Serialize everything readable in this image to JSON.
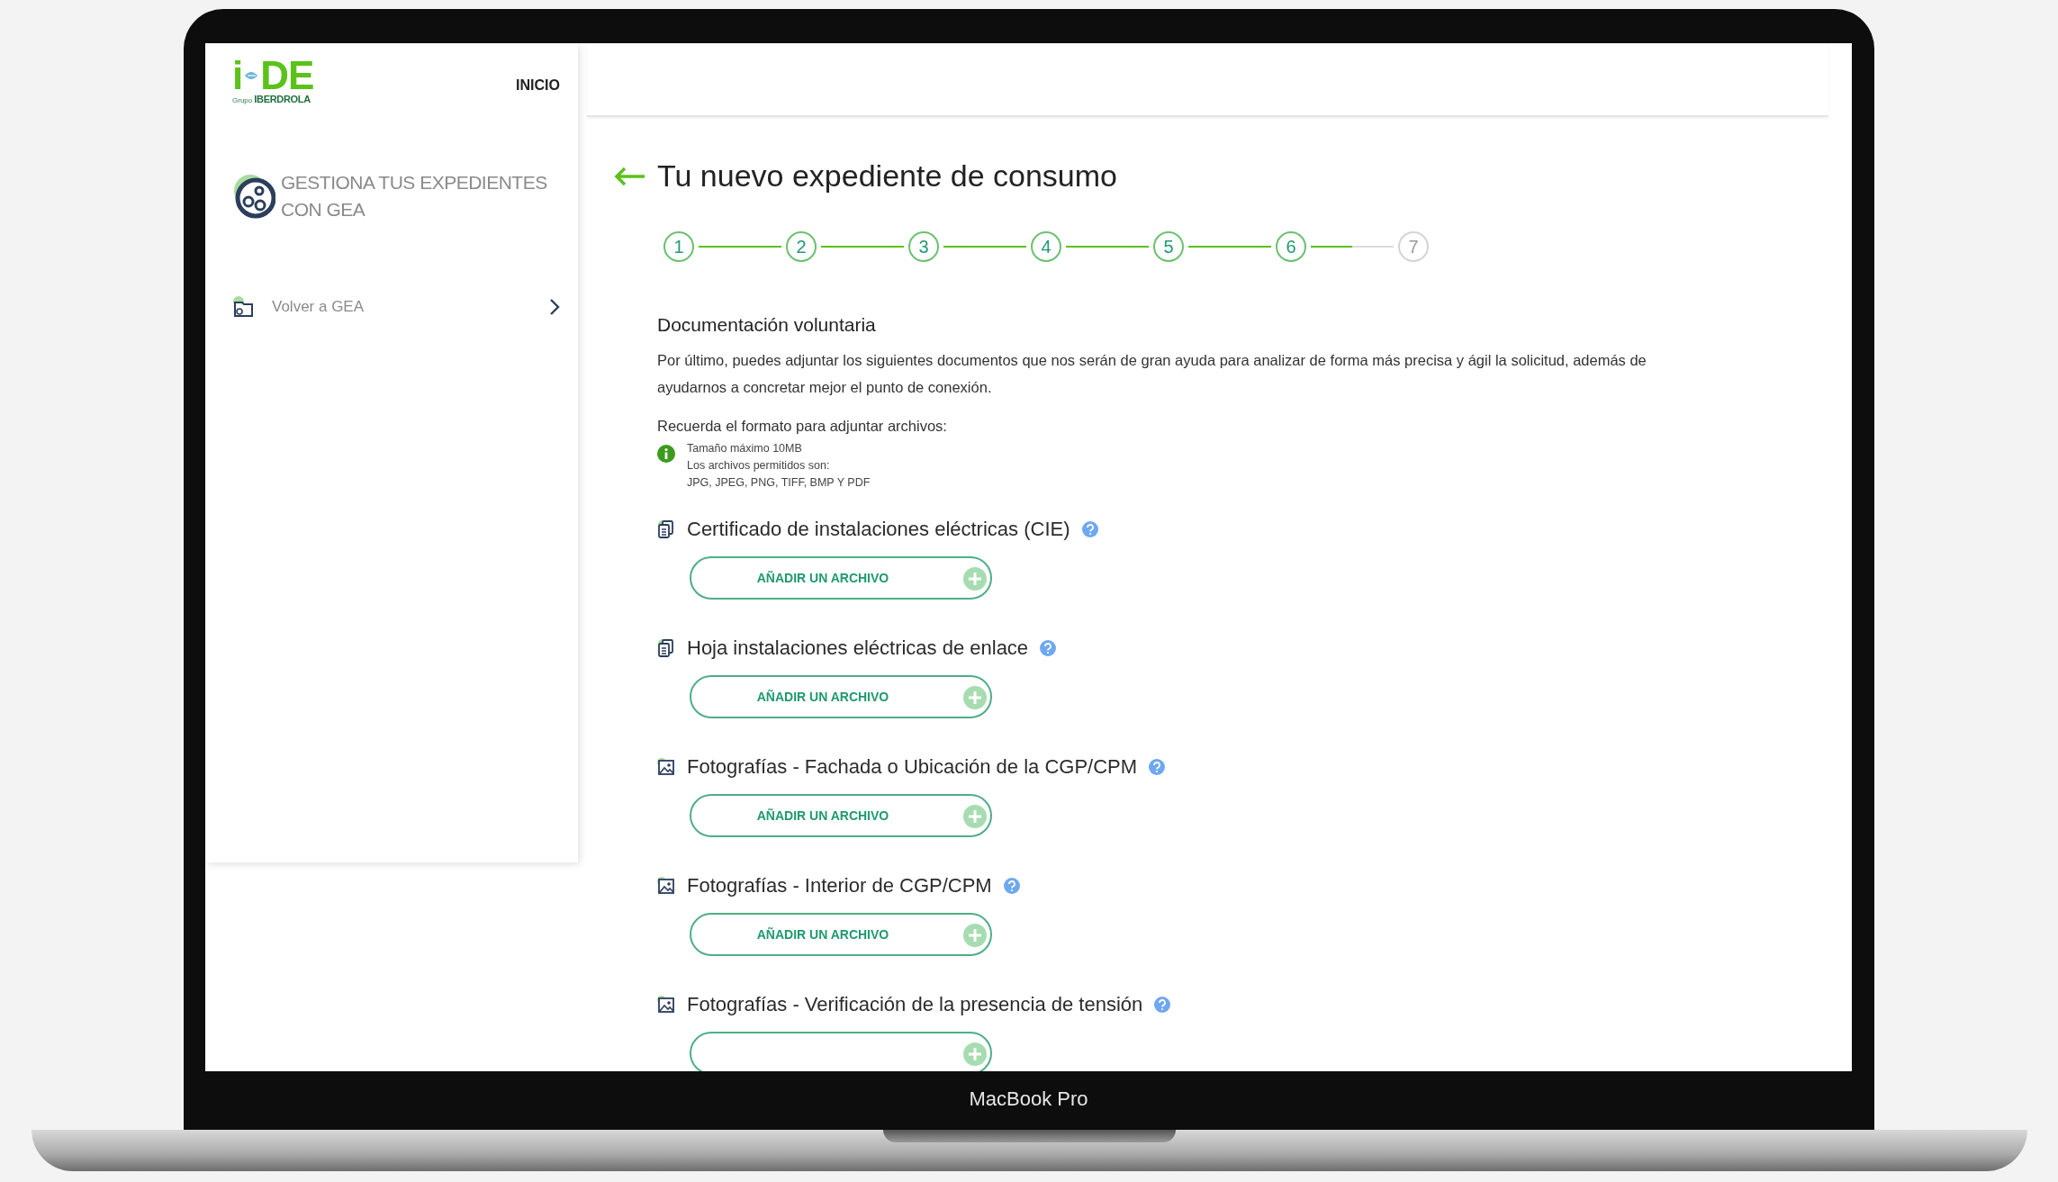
{
  "device": {
    "label": "MacBook Pro"
  },
  "sidebar": {
    "logo": {
      "letter": "i",
      "letters": "DE",
      "group": "Grupo",
      "brand": "IBERDROLA"
    },
    "nav_link": "INICIO",
    "title": "GESTIONA TUS EXPEDIENTES CON GEA",
    "items": [
      {
        "label": "Volver a GEA"
      }
    ]
  },
  "main": {
    "title": "Tu nuevo expediente de consumo",
    "steps": [
      {
        "label": "1",
        "done": true,
        "level": 1
      },
      {
        "label": "2",
        "done": true,
        "level": 1
      },
      {
        "label": "3",
        "done": true,
        "level": 1
      },
      {
        "label": "4",
        "done": true,
        "level": 1
      },
      {
        "label": "5",
        "done": true,
        "level": 1
      },
      {
        "label": "6",
        "done": true,
        "level": 0.5
      },
      {
        "label": "7",
        "done": false
      }
    ],
    "section": {
      "heading": "Documentación voluntaria",
      "intro": "Por último, puedes adjuntar los siguientes documentos que nos serán de gran ayuda para analizar de forma más precisa y ágil la solicitud, además de ayudarnos a concretar mejor el punto de conexión.",
      "format_label": "Recuerda el formato para adjuntar archivos:",
      "format_notes": [
        "Tamaño máximo 10MB",
        "Los archivos permitidos son:",
        "JPG, JPEG, PNG, TIFF, BMP Y PDF"
      ]
    },
    "documents": [
      {
        "kind": "document",
        "title": "Certificado de instalaciones eléctricas (CIE)",
        "button": "AÑADIR UN ARCHIVO"
      },
      {
        "kind": "document",
        "title": "Hoja instalaciones eléctricas de enlace",
        "button": "AÑADIR UN ARCHIVO"
      },
      {
        "kind": "photo",
        "title": "Fotografías - Fachada o Ubicación de la CGP/CPM",
        "button": "AÑADIR UN ARCHIVO"
      },
      {
        "kind": "photo",
        "title": "Fotografías - Interior de CGP/CPM",
        "button": "AÑADIR UN ARCHIVO"
      },
      {
        "kind": "photo",
        "title": "Fotografías - Verificación de la presencia de tensión"
      }
    ]
  }
}
